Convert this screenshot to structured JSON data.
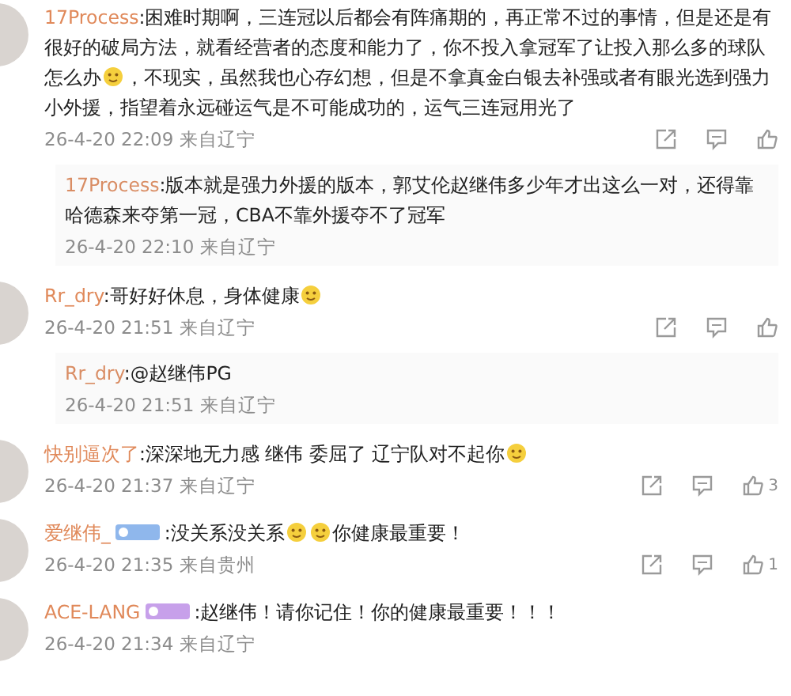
{
  "comments": [
    {
      "author": "17Process",
      "parts": [
        {
          "text": ":困难时期啊，三连冠以后都会有阵痛期的，再正常不过的事情，但是还是有很好的破局方法，就看经营者的态度和能力了，你不投入拿冠军了让投入那么多的球队怎么办",
          "emoji": true
        },
        {
          "text": "，不现实，虽然我也心存幻想，但是不拿真金白银去补强或者有眼光选到强力小外援，指望着永远碰运气是不可能成功的，运气三连冠用光了"
        }
      ],
      "time": "26-4-20 22:09",
      "source": "来自辽宁",
      "actions": true,
      "replies": [
        {
          "author": "17Process",
          "text": ":版本就是强力外援的版本，郭艾伦赵继伟多少年才出这么一对，还得靠哈德森来夺第一冠，CBA不靠外援夺不了冠军",
          "time": "26-4-20 22:10",
          "source": "来自辽宁"
        }
      ]
    },
    {
      "author": "Rr_dry",
      "parts": [
        {
          "text": ":哥好好休息，身体健康",
          "emoji": true
        }
      ],
      "time": "26-4-20 21:51",
      "source": "来自辽宁",
      "actions": true,
      "replies": [
        {
          "author": "Rr_dry",
          "text": ":@赵继伟PG",
          "time": "26-4-20 21:51",
          "source": "来自辽宁"
        }
      ]
    },
    {
      "author": "快别逼次了",
      "parts": [
        {
          "text": ":深深地无力感 继伟 委屈了 辽宁队对不起你",
          "emoji": true
        }
      ],
      "time": "26-4-20 21:37",
      "source": "来自辽宁",
      "actions": true,
      "likes": "3"
    },
    {
      "author": "爱继伟_",
      "badge": true,
      "parts": [
        {
          "text": ":没关系没关系",
          "emoji": true
        },
        {
          "emoji": true
        },
        {
          "text": "你健康最重要！"
        }
      ],
      "time": "26-4-20 21:35",
      "source": "来自贵州",
      "actions": true,
      "likes": "1"
    },
    {
      "author": "ACE-LANG",
      "badge": true,
      "parts": [
        {
          "text": ":赵继伟！请你记住！你的健康最重要！！！"
        }
      ],
      "time": "26-4-20 21:34",
      "source": "来自辽宁",
      "actions": false
    }
  ]
}
